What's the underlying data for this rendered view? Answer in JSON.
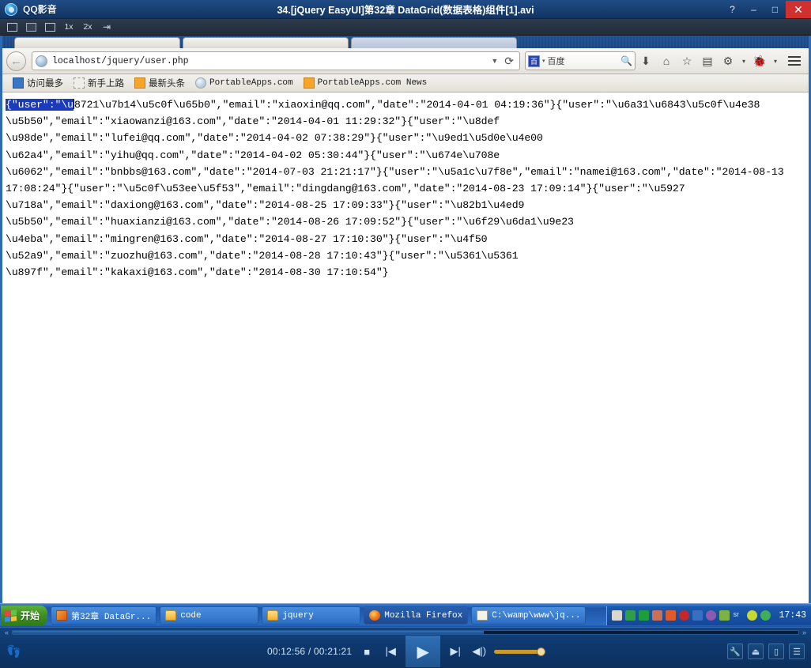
{
  "player": {
    "app_name": "QQ影音",
    "title": "34.[jQuery EasyUI]第32章 DataGrid(数据表格)组件[1].avi",
    "window_buttons": {
      "help": "?",
      "minimize": "–",
      "maximize": "□",
      "close": "✕"
    },
    "toolbar": {
      "screenshot_label": "",
      "frame_label": "",
      "cut_label": "",
      "speed_1x": "1x",
      "speed_2x": "2x",
      "pin_label": ""
    },
    "controls": {
      "current_time": "00:12:56",
      "separator": "/",
      "total_time": "00:21:21",
      "time_display": "00:12:56 / 00:21:21",
      "stop": "■",
      "prev": "|◀",
      "play": "▶",
      "next": "▶|",
      "volume": "◀|)"
    }
  },
  "browser": {
    "tabs": [
      {
        "title": ""
      },
      {
        "title": ""
      },
      {
        "title": ""
      }
    ],
    "nav": {
      "back_icon": "←",
      "url_host": "localhost",
      "url_path": "/jquery/user.php",
      "url_full": "localhost/jquery/user.php",
      "dropdown_icon": "▼",
      "reload_icon": "⟳"
    },
    "search": {
      "engine": "百度",
      "caret": "▾",
      "icon_label": "百",
      "magnifier": "🔍"
    },
    "toolbar_icons": [
      {
        "name": "downloads-icon",
        "glyph": "⬇"
      },
      {
        "name": "home-icon",
        "glyph": "⌂"
      },
      {
        "name": "bookmark-star-icon",
        "glyph": "☆"
      },
      {
        "name": "reader-icon",
        "glyph": "▤"
      },
      {
        "name": "addon-gear-icon",
        "glyph": "⚙"
      },
      {
        "name": "chevron-down-icon",
        "glyph": "▾"
      },
      {
        "name": "firebug-icon",
        "glyph": "🐞"
      },
      {
        "name": "chevron-down-2-icon",
        "glyph": "▾"
      }
    ],
    "bookmarks": [
      {
        "label": "访问最多",
        "icon": "blue"
      },
      {
        "label": "新手上路",
        "icon": "dash"
      },
      {
        "label": "最新头条",
        "icon": "rss"
      },
      {
        "label": "PortableApps.com",
        "icon": "globe"
      },
      {
        "label": "PortableApps.com News",
        "icon": "rss"
      }
    ]
  },
  "page": {
    "selected_text": "{\"user\":\"\\u",
    "lines": [
      "8721\\u7b14\\u5c0f\\u65b0\",\"email\":\"xiaoxin@qq.com\",\"date\":\"2014-04-01 04:19:36\"}{\"user\":\"\\u6a31\\u6843\\u5c0f\\u4e38",
      "\\u5b50\",\"email\":\"xiaowanzi@163.com\",\"date\":\"2014-04-01 11:29:32\"}{\"user\":\"\\u8def",
      "\\u98de\",\"email\":\"lufei@qq.com\",\"date\":\"2014-04-02 07:38:29\"}{\"user\":\"\\u9ed1\\u5d0e\\u4e00",
      "\\u62a4\",\"email\":\"yihu@qq.com\",\"date\":\"2014-04-02 05:30:44\"}{\"user\":\"\\u674e\\u708e",
      "\\u6062\",\"email\":\"bnbbs@163.com\",\"date\":\"2014-07-03 21:21:17\"}{\"user\":\"\\u5a1c\\u7f8e\",\"email\":\"namei@163.com\",\"date\":\"2014-08-13",
      "17:08:24\"}{\"user\":\"\\u5c0f\\u53ee\\u5f53\",\"email\":\"dingdang@163.com\",\"date\":\"2014-08-23 17:09:14\"}{\"user\":\"\\u5927",
      "\\u718a\",\"email\":\"daxiong@163.com\",\"date\":\"2014-08-25 17:09:33\"}{\"user\":\"\\u82b1\\u4ed9",
      "\\u5b50\",\"email\":\"huaxianzi@163.com\",\"date\":\"2014-08-26 17:09:52\"}{\"user\":\"\\u6f29\\u6da1\\u9e23",
      "\\u4eba\",\"email\":\"mingren@163.com\",\"date\":\"2014-08-27 17:10:30\"}{\"user\":\"\\u4f50",
      "\\u52a9\",\"email\":\"zuozhu@163.com\",\"date\":\"2014-08-28 17:10:43\"}{\"user\":\"\\u5361\\u5361",
      "\\u897f\",\"email\":\"kakaxi@163.com\",\"date\":\"2014-08-30 17:10:54\"}"
    ]
  },
  "taskbar": {
    "start_label": "开始",
    "items": [
      {
        "label": "第32章 DataGr...",
        "icon": "orange"
      },
      {
        "label": "code",
        "icon": "folder"
      },
      {
        "label": "jquery",
        "icon": "folder"
      },
      {
        "label": "Mozilla Firefox",
        "icon": "ff"
      },
      {
        "label": "C:\\wamp\\www\\jq...",
        "icon": "note"
      }
    ],
    "tray_icons": [
      "keyboard",
      "green-app",
      "save",
      "people",
      "chart",
      "shield",
      "network",
      "disc",
      "leaf",
      "sr",
      "plus",
      "guard"
    ],
    "clock": "17:43"
  },
  "colors": {
    "titlebar": "#1a4277",
    "close_button": "#cf3030",
    "selection": "#1b3bbb",
    "taskbar": "#2a69c0",
    "start_green": "#418f23",
    "player_bar": "#0f3a70",
    "volume": "#c99a2c"
  }
}
